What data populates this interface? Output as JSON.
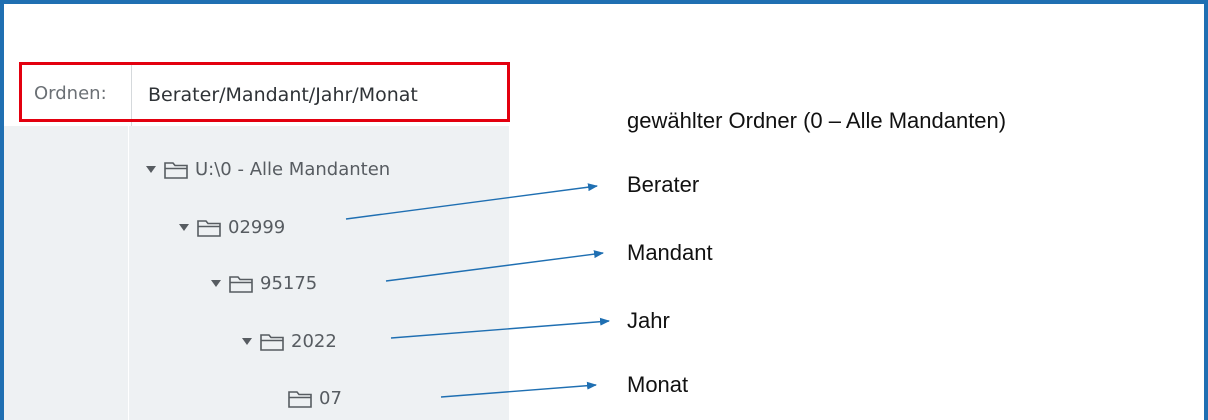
{
  "organize": {
    "label": "Ordnen:",
    "value": "Berater/Mandant/Jahr/Monat"
  },
  "tree": {
    "nodes": [
      {
        "label": "U:\\0 - Alle Mandanten",
        "expanded": true
      },
      {
        "label": "02999",
        "expanded": true
      },
      {
        "label": "95175",
        "expanded": true
      },
      {
        "label": "2022",
        "expanded": true
      },
      {
        "label": "07",
        "expanded": false
      }
    ]
  },
  "annotations": {
    "selected_folder": "gewählter Ordner (0 – Alle Mandanten)",
    "advisor": "Berater",
    "client": "Mandant",
    "year": "Jahr",
    "month": "Monat"
  },
  "colors": {
    "frame": "#1f6fb2",
    "highlight": "#e3000f",
    "arrow": "#1f6fb2",
    "panel": "#eef1f3"
  }
}
